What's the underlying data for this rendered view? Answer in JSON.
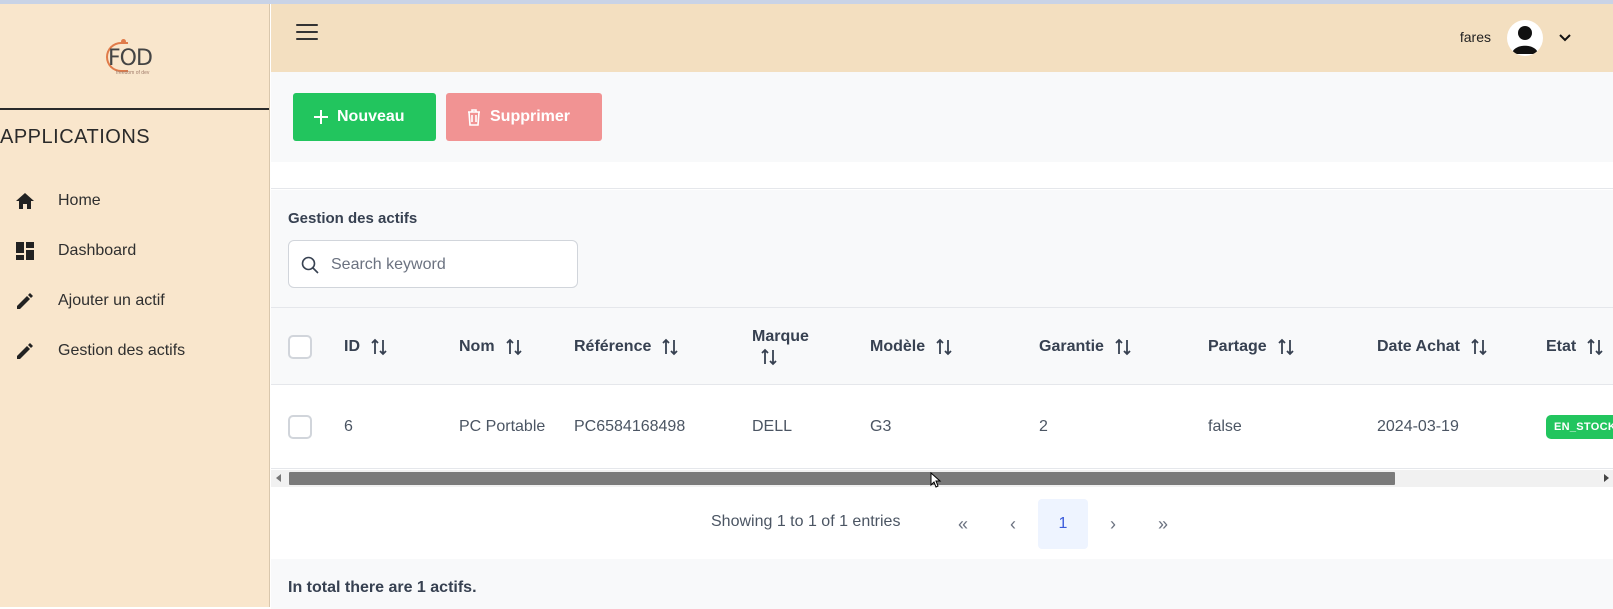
{
  "logo": {
    "text": "FOD",
    "subtitle": "freedom of dev"
  },
  "sidebar": {
    "section_title": "APPLICATIONS",
    "items": [
      {
        "label": "Home",
        "icon": "home-icon"
      },
      {
        "label": "Dashboard",
        "icon": "dashboard-icon"
      },
      {
        "label": "Ajouter un actif",
        "icon": "pencil-icon"
      },
      {
        "label": "Gestion des actifs",
        "icon": "pencil-icon"
      }
    ]
  },
  "header": {
    "user_name": "fares"
  },
  "toolbar": {
    "new_label": "Nouveau",
    "delete_label": "Supprimer"
  },
  "card": {
    "title": "Gestion des actifs",
    "search_placeholder": "Search keyword"
  },
  "table": {
    "columns": [
      "ID",
      "Nom",
      "Référence",
      "Marque",
      "Modèle",
      "Garantie",
      "Partage",
      "Date Achat",
      "Etat"
    ],
    "rows": [
      {
        "id": "6",
        "nom": "PC Portable",
        "reference": "PC6584168498",
        "marque": "DELL",
        "modele": "G3",
        "garantie": "2",
        "partage": "false",
        "date_achat": "2024-03-19",
        "etat": "EN_STOCK"
      }
    ]
  },
  "paginator": {
    "info": "Showing 1 to 1 of 1 entries",
    "first": "«",
    "prev": "‹",
    "current_page": "1",
    "next": "›",
    "last": "»"
  },
  "footer": {
    "text": "In total there are 1 actifs."
  },
  "colors": {
    "sidebar_bg": "#f9e6cc",
    "header_bg": "#f3dfc0",
    "new_button": "#22c55e",
    "delete_button": "#f19393",
    "status_badge": "#22c55e"
  }
}
